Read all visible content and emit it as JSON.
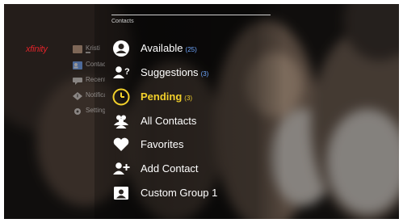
{
  "brand": "xfinity",
  "sidebar": {
    "items": [
      {
        "label": "Kristi",
        "icon": "avatar-icon",
        "selected": false
      },
      {
        "label": "Contacts",
        "icon": "contacts-icon",
        "selected": true
      },
      {
        "label": "Recent",
        "icon": "recent-calls-icon",
        "selected": false
      },
      {
        "label": "Notifications",
        "icon": "notifications-icon",
        "selected": false
      },
      {
        "label": "Settings",
        "icon": "gear-icon",
        "selected": false
      }
    ]
  },
  "section": {
    "title": "Contacts"
  },
  "menu": {
    "items": [
      {
        "label": "Available",
        "count": "(25)",
        "icon": "available-contacts-icon"
      },
      {
        "label": "Suggestions",
        "count": "(3)",
        "icon": "suggestions-icon"
      },
      {
        "label": "Pending",
        "count": "(3)",
        "icon": "clock-icon",
        "selected": true
      },
      {
        "label": "All Contacts",
        "count": "",
        "icon": "group-icon"
      },
      {
        "label": "Favorites",
        "count": "",
        "icon": "heart-icon"
      },
      {
        "label": "Add Contact",
        "count": "",
        "icon": "add-contact-icon"
      },
      {
        "label": "Custom Group 1",
        "count": "",
        "icon": "custom-group-icon"
      }
    ]
  },
  "colors": {
    "brand": "#e1232a",
    "count": "#6fa8ff",
    "selected": "#f2d02b",
    "text": "#ffffff"
  }
}
